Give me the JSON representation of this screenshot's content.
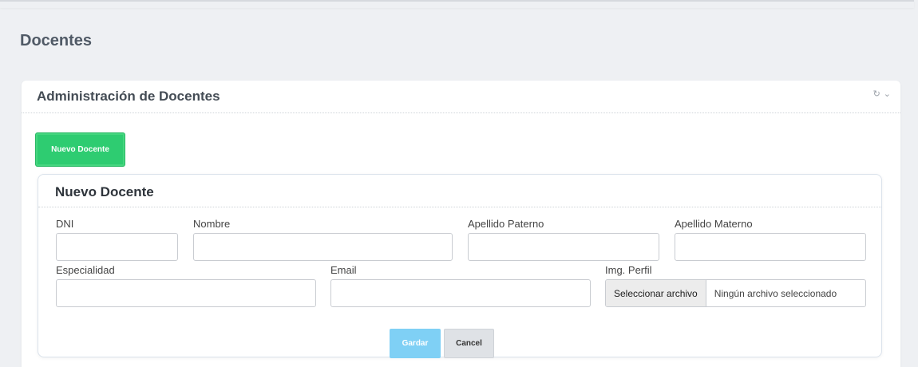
{
  "page": {
    "title": "Docentes"
  },
  "card": {
    "title": "Administración de Docentes",
    "tools": {
      "refresh_icon": "refresh-icon",
      "collapse_icon": "chevron-down-icon"
    },
    "new_button_label": "Nuevo Docente"
  },
  "form": {
    "title": "Nuevo Docente",
    "fields": {
      "dni": {
        "label": "DNI",
        "value": ""
      },
      "nombre": {
        "label": "Nombre",
        "value": ""
      },
      "apellido_paterno": {
        "label": "Apellido Paterno",
        "value": ""
      },
      "apellido_materno": {
        "label": "Apellido Materno",
        "value": ""
      },
      "especialidad": {
        "label": "Especialidad",
        "value": ""
      },
      "email": {
        "label": "Email",
        "value": ""
      },
      "img_perfil": {
        "label": "Img. Perfil",
        "button_label": "Seleccionar archivo",
        "status": "Ningún archivo seleccionado"
      }
    },
    "save_label": "Gardar",
    "cancel_label": "Cancel"
  },
  "colors": {
    "primary_green": "#2ecc71",
    "save_blue": "#7fd0f5",
    "cancel_gray": "#dfe2e6",
    "background": "#eef0f3"
  }
}
